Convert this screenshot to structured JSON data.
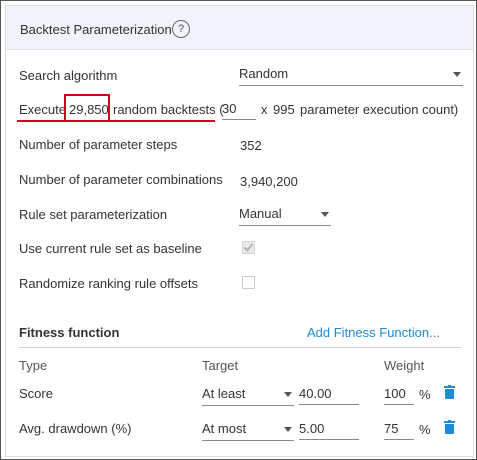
{
  "panel": {
    "title": "Backtest Parameterization",
    "help_glyph": "?"
  },
  "search_algorithm": {
    "label": "Search algorithm",
    "value": "Random"
  },
  "execute": {
    "prefix": "Execute",
    "count": "29,850",
    "middle": "random backtests (",
    "multiplier_input": "30",
    "times": "x",
    "execution_count": "995",
    "suffix": "parameter execution count)"
  },
  "steps": {
    "label": "Number of parameter steps",
    "value": "352"
  },
  "combinations": {
    "label": "Number of parameter combinations",
    "value": "3,940,200"
  },
  "rule_set_param": {
    "label": "Rule set parameterization",
    "value": "Manual"
  },
  "use_current": {
    "label": "Use current rule set as baseline",
    "checked": true
  },
  "randomize": {
    "label": "Randomize ranking rule offsets",
    "checked": false
  },
  "fitness": {
    "title": "Fitness function",
    "add_label": "Add Fitness Function...",
    "columns": {
      "type": "Type",
      "target": "Target",
      "weight": "Weight"
    },
    "rows": [
      {
        "type": "Score",
        "target": "At least",
        "value": "40.00",
        "weight": "100",
        "unit": "%"
      },
      {
        "type": "Avg. drawdown (%)",
        "target": "At most",
        "value": "5.00",
        "weight": "75",
        "unit": "%"
      }
    ]
  },
  "colors": {
    "accent": "#1f8ad6",
    "highlight": "#d0021b",
    "header_bg": "#eef4fa"
  },
  "icons": {
    "help": "question-circle-icon",
    "dropdown": "caret-down-icon",
    "delete": "trash-icon"
  }
}
